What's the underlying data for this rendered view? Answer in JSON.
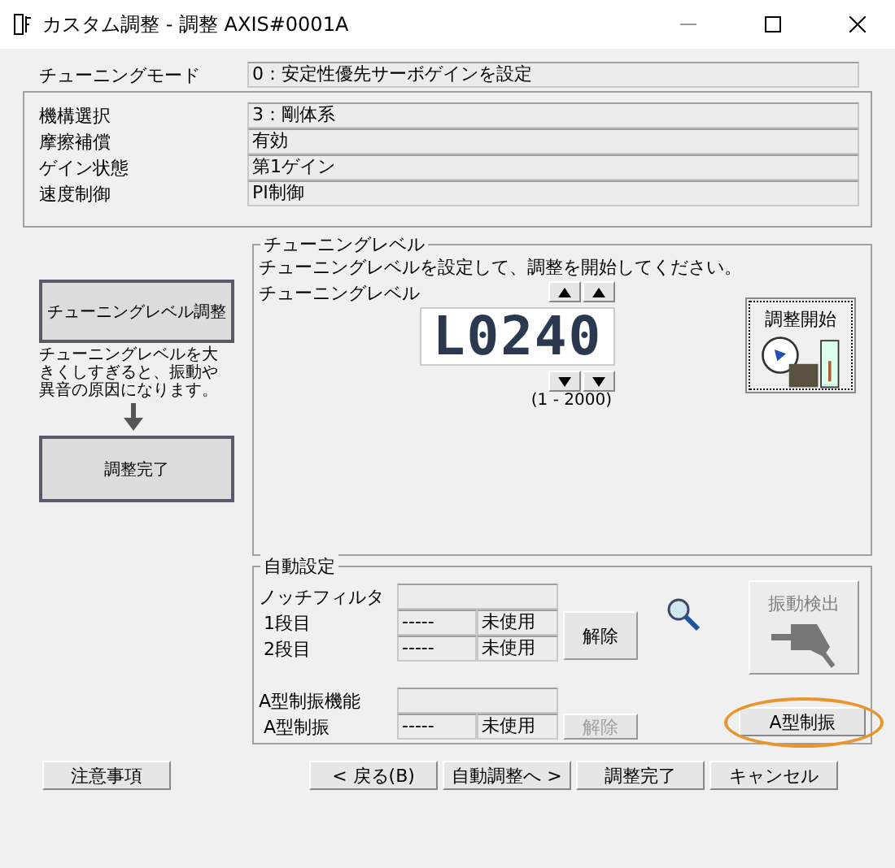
{
  "window": {
    "title": "カスタム調整 - 調整 AXIS#0001A"
  },
  "mode": {
    "label": "チューニングモード",
    "value": "0：安定性優先サーボゲインを設定"
  },
  "details": [
    {
      "label": "機構選択",
      "value": "3：剛体系"
    },
    {
      "label": "摩擦補償",
      "value": "有効"
    },
    {
      "label": "ゲイン状態",
      "value": "第1ゲイン"
    },
    {
      "label": "速度制御",
      "value": "PI制御"
    }
  ],
  "flow": {
    "steps": [
      {
        "label": "チューニングレベル調整"
      },
      {
        "label": "調整完了"
      }
    ],
    "note": "チューニングレベルを大きくしすぎると、振動や異音の原因になります。"
  },
  "tuning": {
    "title": "チューニングレベル",
    "instruction": "チューニングレベルを設定して、調整を開始してください。",
    "label": "チューニングレベル",
    "display": "L0240",
    "range": "(1 - 2000)",
    "start_button": "調整開始"
  },
  "auto": {
    "title": "自動設定",
    "notch_label": "ノッチフィルタ",
    "notch_rows": [
      {
        "label": "1段目",
        "value": "-----",
        "status": "未使用"
      },
      {
        "label": "2段目",
        "value": "-----",
        "status": "未使用"
      }
    ],
    "notch_release": {
      "label": "解除",
      "disabled": false
    },
    "a_label": "A型制振機能",
    "a_row": {
      "label": "A型制振",
      "value": "-----",
      "status": "未使用"
    },
    "a_release": {
      "label": "解除",
      "disabled": true
    },
    "detect_button": {
      "label": "振動検出",
      "disabled": true
    },
    "a_button": {
      "label": "A型制振",
      "highlighted": true
    }
  },
  "help_button": "注意事項",
  "buttons": [
    "< 戻る(B)",
    "自動調整へ >",
    "調整完了",
    "キャンセル"
  ]
}
